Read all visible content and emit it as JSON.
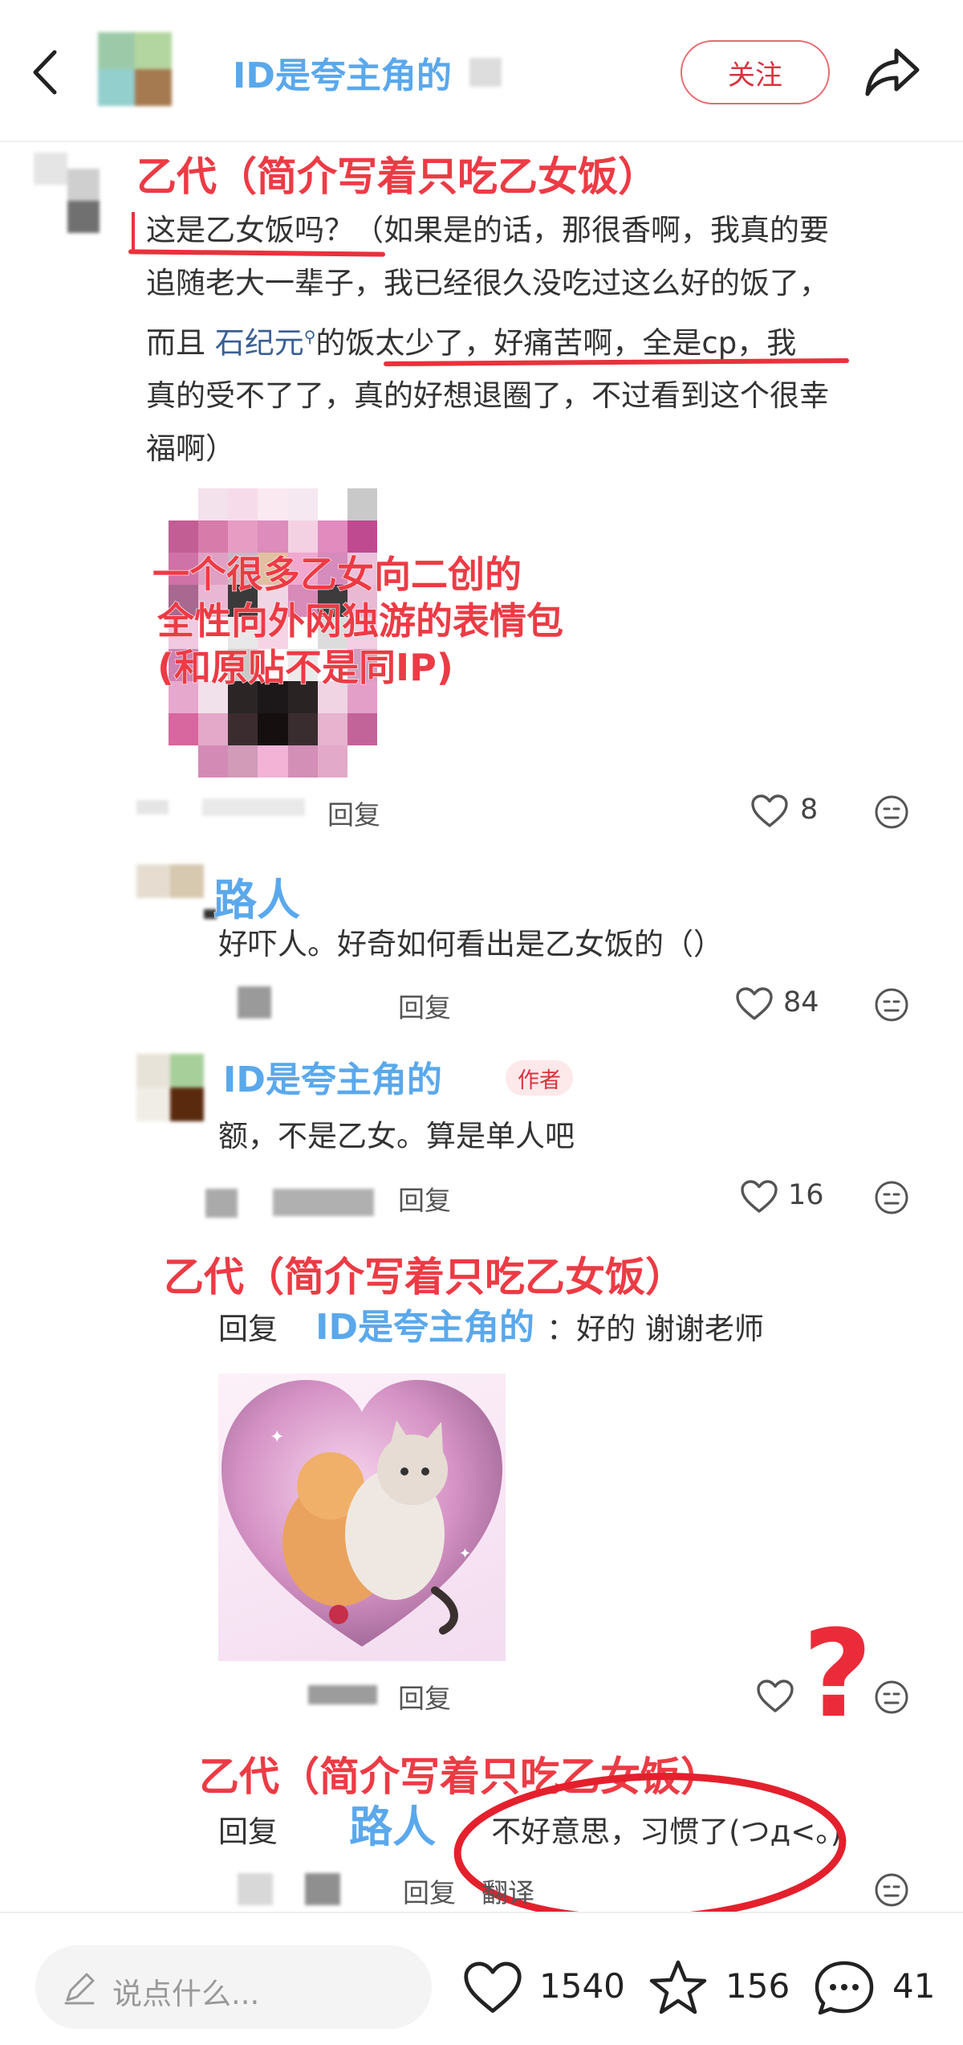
{
  "header": {
    "author_name": "ID是夸主角的",
    "follow_label": "关注",
    "colors": {
      "follow_border": "#e86a72",
      "follow_text": "#d9333f"
    }
  },
  "comments": [
    {
      "annotation": "乙代（简介写着只吃乙女饭）",
      "lines": [
        "这是乙女饭吗？（如果是的话，那很香啊，我真的要",
        "追随老大一辈子，我已经很久没吃过这么好的饭了，",
        "而且 ",
        "的饭太少了，好痛苦啊，全是cp，我",
        "真的受不了了，真的好想退圈了，不过看到这个很幸",
        "福啊）"
      ],
      "link_text": "石纪元",
      "image_annotation": [
        "一个很多乙女向二创的",
        "全性向外网独游的表情包",
        "(和原贴不是同IP)"
      ],
      "reply_label": "回复",
      "likes": "8"
    },
    {
      "annotation": "路人",
      "text": "好吓人。好奇如何看出是乙女饭的（）",
      "reply_label": "回复",
      "likes": "84"
    },
    {
      "annotation": "ID是夸主角的",
      "badge": "作者",
      "text": "额，不是乙女。算是单人吧",
      "reply_label": "回复",
      "likes": "16"
    },
    {
      "annotation": "乙代（简介写着只吃乙女饭）",
      "reply_prefix": "回复",
      "reply_to": "ID是夸主角的",
      "text": "：好的  谢谢老师",
      "reply_label": "回复",
      "likes": ""
    },
    {
      "annotation_top": "乙代（简介写着只吃乙女饭）",
      "reply_prefix": "回复",
      "reply_to": "路人",
      "text": "不好意思，习惯了(つд<。)",
      "reply_label": "回复",
      "translate_label": "翻译"
    }
  ],
  "question_mark": "?",
  "bottom_bar": {
    "input_placeholder": "说点什么...",
    "likes": "1540",
    "stars": "156",
    "comments": "41"
  }
}
